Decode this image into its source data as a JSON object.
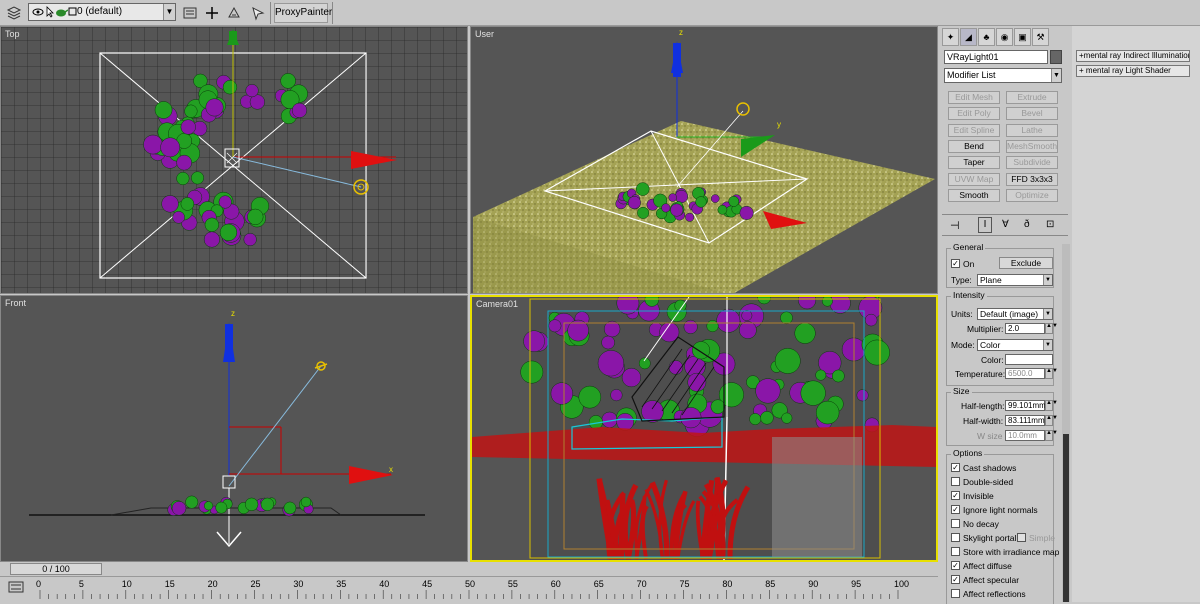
{
  "toolbar": {
    "layer_name": "0 (default)",
    "proxy_button": "ProxyPainter",
    "icons": [
      "layers-icon",
      "eye-icon",
      "pointer-icon",
      "teapot-icon",
      "square-icon",
      "dropdown-arrow-icon",
      "move-icon",
      "clone-icon",
      "select-icon"
    ]
  },
  "viewports": {
    "top": {
      "label": "Top"
    },
    "user": {
      "label": "User"
    },
    "front": {
      "label": "Front"
    },
    "camera": {
      "label": "Camera01"
    }
  },
  "command_panel": {
    "tabs": [
      "create-tab",
      "modify-tab",
      "hierarchy-tab",
      "motion-tab",
      "display-tab",
      "utilities-tab"
    ],
    "object_name": "VRayLight01",
    "modifier_list": "Modifier List",
    "modifier_buttons": [
      {
        "label": "Edit Mesh",
        "enabled": false
      },
      {
        "label": "Extrude",
        "enabled": false
      },
      {
        "label": "Edit Poly",
        "enabled": false
      },
      {
        "label": "Bevel",
        "enabled": false
      },
      {
        "label": "Edit Spline",
        "enabled": false
      },
      {
        "label": "Lathe",
        "enabled": false
      },
      {
        "label": "Bend",
        "enabled": true
      },
      {
        "label": "MeshSmooth",
        "enabled": false
      },
      {
        "label": "Taper",
        "enabled": true
      },
      {
        "label": "Subdivide",
        "enabled": false
      },
      {
        "label": "UVW Map",
        "enabled": false
      },
      {
        "label": "FFD 3x3x3",
        "enabled": true
      },
      {
        "label": "Smooth",
        "enabled": true
      },
      {
        "label": "Optimize",
        "enabled": false
      }
    ],
    "general": {
      "title": "General",
      "on_label": "On",
      "on_checked": true,
      "exclude_button": "Exclude",
      "type_label": "Type:",
      "type_value": "Plane"
    },
    "intensity": {
      "title": "Intensity",
      "units_label": "Units:",
      "units_value": "Default (image)",
      "multiplier_label": "Multiplier:",
      "multiplier_value": "2.0",
      "mode_label": "Mode:",
      "mode_value": "Color",
      "color_label": "Color:",
      "color_value": "#ffffff",
      "temperature_label": "Temperature:",
      "temperature_value": "6500.0"
    },
    "size": {
      "title": "Size",
      "half_length_label": "Half-length:",
      "half_length_value": "99.101mm",
      "half_width_label": "Half-width:",
      "half_width_value": "83.111mm",
      "w_size_label": "W size",
      "w_size_value": "10.0mm"
    },
    "options": {
      "title": "Options",
      "items": [
        {
          "label": "Cast shadows",
          "checked": true
        },
        {
          "label": "Double-sided",
          "checked": false
        },
        {
          "label": "Invisible",
          "checked": true
        },
        {
          "label": "Ignore light normals",
          "checked": true
        },
        {
          "label": "No decay",
          "checked": false
        },
        {
          "label": "Skylight portal",
          "checked": false
        },
        {
          "label": "Store with irradiance map",
          "checked": false
        },
        {
          "label": "Affect diffuse",
          "checked": true
        },
        {
          "label": "Affect specular",
          "checked": true
        },
        {
          "label": "Affect reflections",
          "checked": false
        }
      ],
      "simple_label": "Simple"
    }
  },
  "right_list": {
    "items": [
      "mental ray Indirect Illumination",
      "mental ray Light Shader"
    ]
  },
  "timeline": {
    "slider_label": "0 / 100",
    "ticks": [
      "0",
      "5",
      "10",
      "15",
      "20",
      "25",
      "30",
      "35",
      "40",
      "45",
      "50",
      "55",
      "60",
      "65",
      "70",
      "75",
      "80",
      "85",
      "90",
      "95",
      "100"
    ]
  },
  "colors": {
    "viewport_bg": "#555555",
    "active_viewport_border": "#e8e000",
    "foliage_green": "#22a022",
    "foliage_purple": "#8a16a8",
    "x_axis": "#e01010",
    "y_axis": "#22b022",
    "z_axis": "#1030e0"
  }
}
